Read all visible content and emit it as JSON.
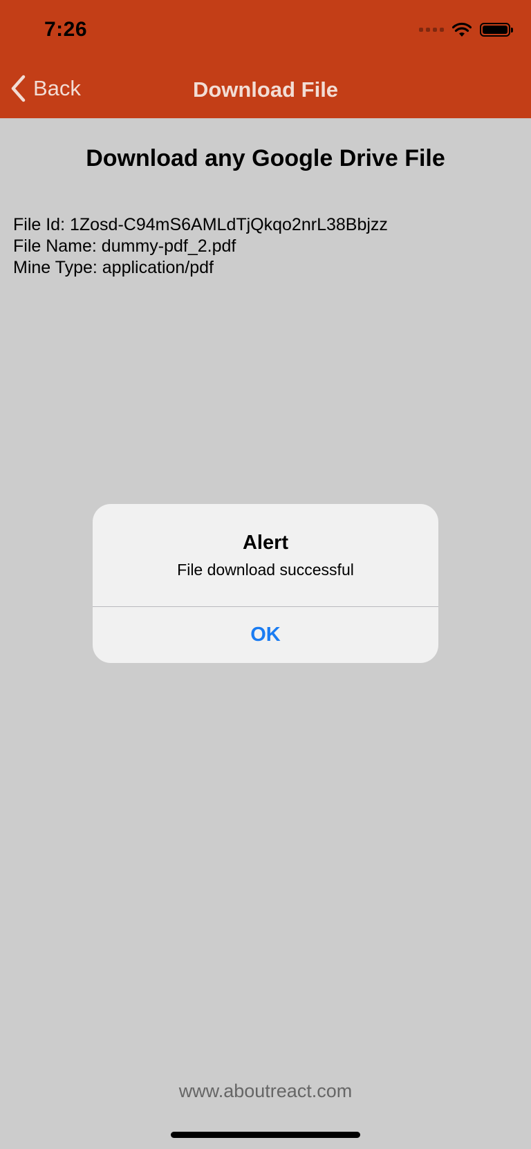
{
  "status_bar": {
    "time": "7:26"
  },
  "nav": {
    "back_label": "Back",
    "title": "Download File",
    "background_color": "#c33e17"
  },
  "content": {
    "heading": "Download any Google Drive File",
    "file_id": "File Id: 1Zosd-C94mS6AMLdTjQkqo2nrL38Bbjzz",
    "file_name": "File Name: dummy-pdf_2.pdf",
    "mime_type": "Mine Type: application/pdf"
  },
  "alert": {
    "title": "Alert",
    "message": "File download successful",
    "ok_label": "OK",
    "button_color": "#1a7cf2"
  },
  "footer": {
    "url": "www.aboutreact.com"
  }
}
